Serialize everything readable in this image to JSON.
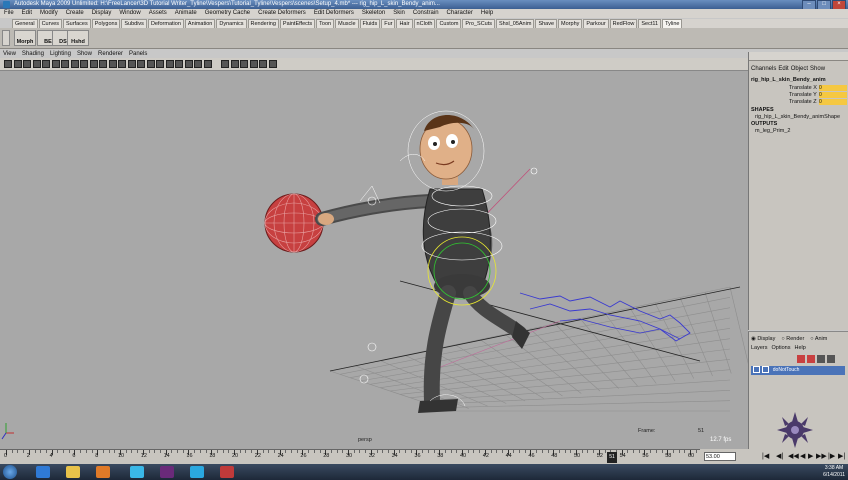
{
  "window": {
    "title": "Autodesk Maya 2009 Unlimited: H:\\FreeLancer\\3D Tutorial Writer_Tyline\\Vespers\\Tutorial_Tyline\\Vespers\\scenes\\Setup_4.mb* --- rig_hip_L_skin_Bendy_anim..."
  },
  "main_menu": [
    "File",
    "Edit",
    "Modify",
    "Create",
    "Display",
    "Window",
    "Assets",
    "Animate",
    "Geometry Cache",
    "Create Deformers",
    "Edit Deformers",
    "Skeleton",
    "Skin",
    "Constrain",
    "Character",
    "Help"
  ],
  "shelf_tabs": [
    "General",
    "Curves",
    "Surfaces",
    "Polygons",
    "Subdivs",
    "Deformation",
    "Animation",
    "Dynamics",
    "Rendering",
    "PaintEffects",
    "Toon",
    "Muscle",
    "Fluids",
    "Fur",
    "Hair",
    "nCloth",
    "Custom",
    "Pro_SCuts",
    "Shsl_05Anim",
    "Shave",
    "Morphy",
    "Parkour",
    "RedFlow",
    "Sect11",
    "Tyline"
  ],
  "shelf_buttons": [
    "Morph",
    "BE",
    "DS",
    "Hshd"
  ],
  "panel_menu": [
    "View",
    "Shading",
    "Lighting",
    "Show",
    "Renderer",
    "Panels"
  ],
  "viewport": {
    "camera_label": "persp",
    "frame_label": "Frame:",
    "frame_value": "51",
    "fps_label": "12.7 fps",
    "axis_labels": [
      "x",
      "y",
      "z"
    ]
  },
  "channel_box": {
    "tabs": [
      "Channels",
      "Edit",
      "Object",
      "Show"
    ],
    "object_name": "rig_hip_L_skin_Bendy_anim",
    "attributes": [
      {
        "name": "Translate X",
        "value": "0"
      },
      {
        "name": "Translate Y",
        "value": "0"
      },
      {
        "name": "Translate Z",
        "value": "0"
      }
    ],
    "shapes_label": "SHAPES",
    "shape_name": "rig_hip_L_skin_Bendy_animShape",
    "outputs_label": "OUTPUTS",
    "output_name": "m_leg_Prim_2"
  },
  "layer_editor": {
    "modes": [
      "Display",
      "Render",
      "Anim"
    ],
    "menu": [
      "Layers",
      "Options",
      "Help"
    ],
    "layer_name": "doNotTouch"
  },
  "timeline": {
    "ticks": [
      "0",
      "2",
      "4",
      "6",
      "8",
      "10",
      "12",
      "14",
      "16",
      "18",
      "20",
      "22",
      "24",
      "26",
      "28",
      "30",
      "32",
      "34",
      "36",
      "38",
      "40",
      "42",
      "44",
      "46",
      "48",
      "50",
      "52",
      "54",
      "56",
      "58",
      "60"
    ],
    "current_frame": "51",
    "current_time_field": "53.00",
    "playback_buttons": [
      "|◀",
      "◀|",
      "◀◀",
      "◀",
      "▶",
      "▶▶",
      "|▶",
      "▶|"
    ]
  },
  "taskbar": {
    "time": "3:38 AM",
    "date": "6/14/2011"
  },
  "colors": {
    "viewport_bg": "#a8a8a8",
    "selection_yellow": "#f5c842",
    "layer_blue": "#4a73b8",
    "joint_blue": "#3a3ad0",
    "ball_red": "#d04040"
  }
}
